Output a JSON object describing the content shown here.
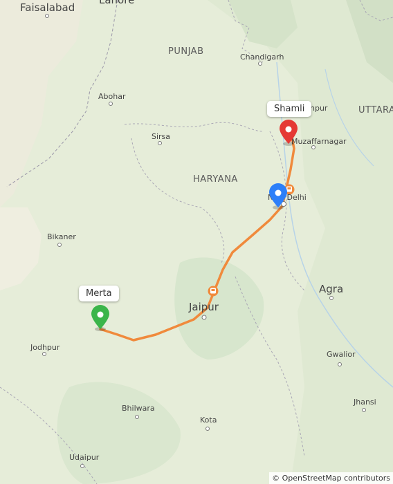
{
  "map": {
    "regions": {
      "punjab": "PUNJAB",
      "haryana": "HARYANA",
      "uttar": "UTTARA"
    },
    "cities": {
      "faisalabad": "Faisalabad",
      "lahore": "Lahore",
      "chandigarh": "Chandigarh",
      "abohar": "Abohar",
      "sirsa": "Sirsa",
      "saharanpur": "npur",
      "muzaffarnagar": "Muzaffarnagar",
      "new_delhi": "New Delhi",
      "bikaner": "Bikaner",
      "agra": "Agra",
      "jaipur": "Jaipur",
      "jodhpur": "Jodhpur",
      "gwalior": "Gwalior",
      "bhilwara": "Bhilwara",
      "jhansi": "Jhansi",
      "kota": "Kota",
      "udaipur": "Udaipur"
    },
    "markers": {
      "origin": {
        "label": "Merta",
        "color": "#3bb54a"
      },
      "destination": {
        "label": "Shamli",
        "color": "#e53935"
      },
      "waypoint": {
        "color": "#2d7ff9"
      }
    },
    "route_color": "#f08a3c",
    "attribution": "© OpenStreetMap contributors"
  }
}
